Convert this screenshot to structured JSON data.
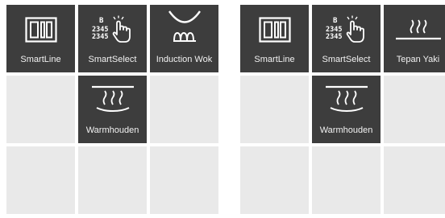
{
  "panels": [
    {
      "tiles": [
        {
          "label": "SmartLine",
          "icon": "smartline-icon"
        },
        {
          "label": "SmartSelect",
          "icon": "smartselect-icon"
        },
        {
          "label": "Induction Wok",
          "icon": "induction-wok-icon"
        },
        {
          "label": "",
          "icon": ""
        },
        {
          "label": "Warmhouden",
          "icon": "warmhouden-icon"
        },
        {
          "label": "",
          "icon": ""
        },
        {
          "label": "",
          "icon": ""
        },
        {
          "label": "",
          "icon": ""
        },
        {
          "label": "",
          "icon": ""
        }
      ]
    },
    {
      "tiles": [
        {
          "label": "SmartLine",
          "icon": "smartline-icon"
        },
        {
          "label": "SmartSelect",
          "icon": "smartselect-icon"
        },
        {
          "label": "Tepan Yaki",
          "icon": "tepan-yaki-icon"
        },
        {
          "label": "",
          "icon": ""
        },
        {
          "label": "Warmhouden",
          "icon": "warmhouden-icon"
        },
        {
          "label": "",
          "icon": ""
        },
        {
          "label": "",
          "icon": ""
        },
        {
          "label": "",
          "icon": ""
        },
        {
          "label": "",
          "icon": ""
        }
      ]
    }
  ],
  "smartselect_glyph": {
    "letter": "B",
    "row1": "2345",
    "row2": "2345"
  },
  "colors": {
    "active_tile": "#3d3d3d",
    "empty_tile": "#e9e9e9",
    "label_text": "#f2f2f2",
    "icon_stroke": "#ffffff"
  }
}
